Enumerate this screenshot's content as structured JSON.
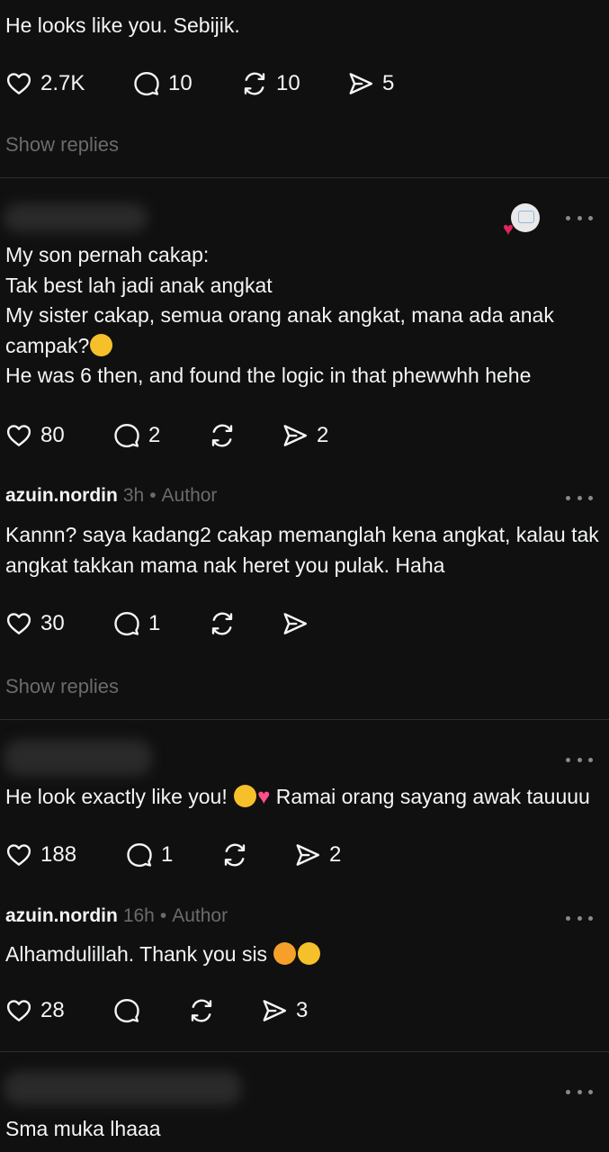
{
  "top": {
    "text": "He looks like you. Sebijik.",
    "counts": {
      "likes": "2.7K",
      "replies": "10",
      "reposts": "10",
      "shares": "5"
    },
    "show_replies": "Show replies"
  },
  "comment1": {
    "lines": [
      "My son pernah cakap:",
      "Tak best lah jadi anak angkat",
      "My sister cakap, semua orang anak angkat, mana ada anak",
      "campak?",
      "He was 6 then, and found the logic in that phewwhh hehe"
    ],
    "counts": {
      "likes": "80",
      "replies": "2",
      "reposts": "",
      "shares": "2"
    },
    "reply": {
      "username": "azuin.nordin",
      "time": "3h",
      "role": "Author",
      "lines": [
        "Kannn? saya kadang2 cakap memanglah kena angkat, kalau tak",
        "angkat takkan mama nak heret you pulak. Haha"
      ],
      "counts": {
        "likes": "30",
        "replies": "1",
        "reposts": "",
        "shares": ""
      }
    },
    "show_replies": "Show replies"
  },
  "comment2": {
    "text_before": "He look exactly like you!",
    "text_after": "Ramai orang sayang awak tauuuu",
    "counts": {
      "likes": "188",
      "replies": "1",
      "reposts": "",
      "shares": "2"
    },
    "reply": {
      "username": "azuin.nordin",
      "time": "16h",
      "role": "Author",
      "text": "Alhamdulillah. Thank you sis",
      "counts": {
        "likes": "28",
        "replies": "",
        "reposts": "",
        "shares": "3"
      }
    }
  },
  "comment3": {
    "text": "Sma muka lhaaa"
  },
  "separator": "•",
  "icons": {
    "like": "heart-icon",
    "reply": "comment-icon",
    "repost": "repost-icon",
    "share": "share-icon",
    "more": "more-icon"
  },
  "colors": {
    "background": "#101010",
    "text": "#f3f5f7",
    "muted": "#6b6b6b",
    "divider": "#2e2e2e",
    "heart": "#e0245e"
  }
}
